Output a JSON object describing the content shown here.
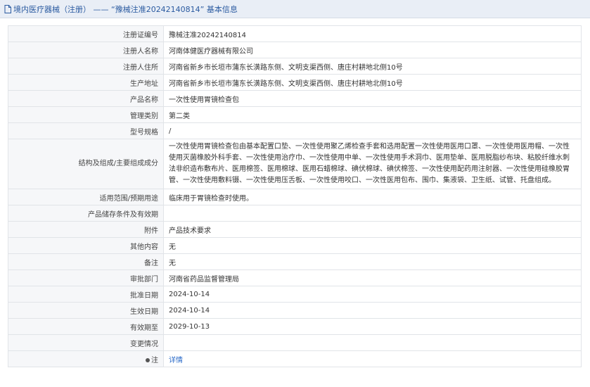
{
  "header": {
    "title": "境内医疗器械（注册） —— “豫械注准20242140814” 基本信息"
  },
  "rows": [
    {
      "label": "注册证编号",
      "value": "豫械注准20242140814"
    },
    {
      "label": "注册人名称",
      "value": "河南体健医疗器械有限公司"
    },
    {
      "label": "注册人住所",
      "value": "河南省新乡市长垣市蒲东长潢路东侧、文明支渠西侧、唐庄村耕地北侧10号"
    },
    {
      "label": "生产地址",
      "value": "河南省新乡市长垣市蒲东长潢路东侧、文明支渠西侧、唐庄村耕地北侧10号"
    },
    {
      "label": "产品名称",
      "value": "一次性使用胃镜检查包"
    },
    {
      "label": "管理类别",
      "value": "第二类"
    },
    {
      "label": "型号规格",
      "value": "/"
    },
    {
      "label": "结构及组成/主要组成成分",
      "value": "一次性使用胃镜检查包由基本配置口垫、一次性使用聚乙烯检查手套和选用配置一次性使用医用口罩、一次性使用医用帽、一次性使用灭菌橡胶外科手套、一次性使用治疗巾、一次性使用中单、一次性使用手术洞巾、医用垫单、医用脱脂纱布块、粘胶纤维水刺法非织造布敷布片、医用棉签、医用棉球、医用石蜡棉球、碘伏棉球、碘伏棉签、一次性使用配药用注射器、一次性使用硅橡胶胃管、一次性使用敷料镊、一次性使用压舌板、一次性使用咬口、一次性医用包布、围巾、集液袋、卫生纸、试管、托盘组成。"
    },
    {
      "label": "适用范围/预期用途",
      "value": "临床用于胃镜检查时使用。"
    },
    {
      "label": "产品储存条件及有效期",
      "value": ""
    },
    {
      "label": "附件",
      "value": "产品技术要求"
    },
    {
      "label": "其他内容",
      "value": "无"
    },
    {
      "label": "备注",
      "value": "无"
    },
    {
      "label": "审批部门",
      "value": "河南省药品监督管理局"
    },
    {
      "label": "批准日期",
      "value": "2024-10-14"
    },
    {
      "label": "生效日期",
      "value": "2024-10-14"
    },
    {
      "label": "有效期至",
      "value": "2029-10-13"
    },
    {
      "label": "变更情况",
      "value": ""
    }
  ],
  "note": {
    "label": "注",
    "link": "详情"
  },
  "colors": {
    "titlebar_bg": "#e9eef6",
    "title_text": "#2a5aa0",
    "label_bg": "#f6f7f9",
    "link": "#2a6ac8"
  }
}
